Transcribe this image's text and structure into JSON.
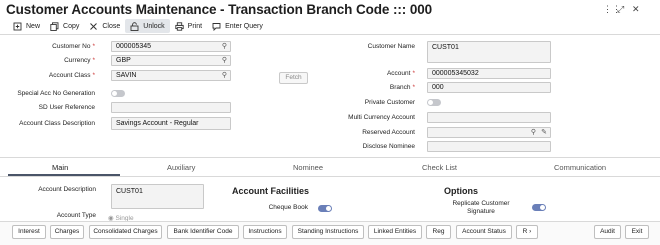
{
  "window": {
    "title": "Customer Accounts Maintenance - Transaction Branch Code ::: 000",
    "controls": [
      "••",
      "↗",
      "×"
    ]
  },
  "toolbar": {
    "new": "New",
    "copy": "Copy",
    "close": "Close",
    "unlock": "Unlock",
    "print": "Print",
    "enter_query": "Enter Query"
  },
  "form": {
    "customer_no_label": "Customer No",
    "customer_no": "000005345",
    "currency_label": "Currency",
    "currency": "GBP",
    "account_class_label": "Account Class",
    "account_class": "SAVIN",
    "fetch_label": "Fetch",
    "special_acc_label": "Special Acc No Generation",
    "sd_user_ref_label": "SD User Reference",
    "sd_user_ref": "",
    "account_class_desc_label": "Account Class Description",
    "account_class_desc": "Savings Account - Regular",
    "customer_name_label": "Customer Name",
    "customer_name": "CUST01",
    "account_label": "Account",
    "account": "000005345032",
    "branch_label": "Branch",
    "branch": "000",
    "private_customer_label": "Private Customer",
    "multi_currency_label": "Multi Currency Account",
    "multi_currency": "",
    "reserved_account_label": "Reserved Account",
    "reserved_account": "",
    "disclose_nominee_label": "Disclose Nominee",
    "disclose_nominee": ""
  },
  "tabs": [
    "Main",
    "Auxiliary",
    "Nominee",
    "Check List",
    "Communication"
  ],
  "main": {
    "account_description_label": "Account Description",
    "account_description": "CUST01",
    "account_type_label": "Account Type",
    "account_type_option": "Single",
    "account_facilities_title": "Account Facilities",
    "cheque_book_label": "Cheque Book",
    "options_title": "Options",
    "replicate_customer_signature_label": "Replicate Customer Signature"
  },
  "bottom_buttons": [
    "Interest",
    "Charges",
    "Consolidated Charges",
    "Bank Identifier Code",
    "Instructions",
    "Standing Instructions",
    "Linked Entities",
    "Reg",
    "Account Status",
    "R"
  ],
  "bottom_actions": {
    "audit": "Audit",
    "exit": "Exit"
  },
  "colors": {
    "toggle_on": "#6a7fb8",
    "toggle_off": "#c5c7cc",
    "required": "#cc3333",
    "active_tab_underline": "#4a5568"
  }
}
